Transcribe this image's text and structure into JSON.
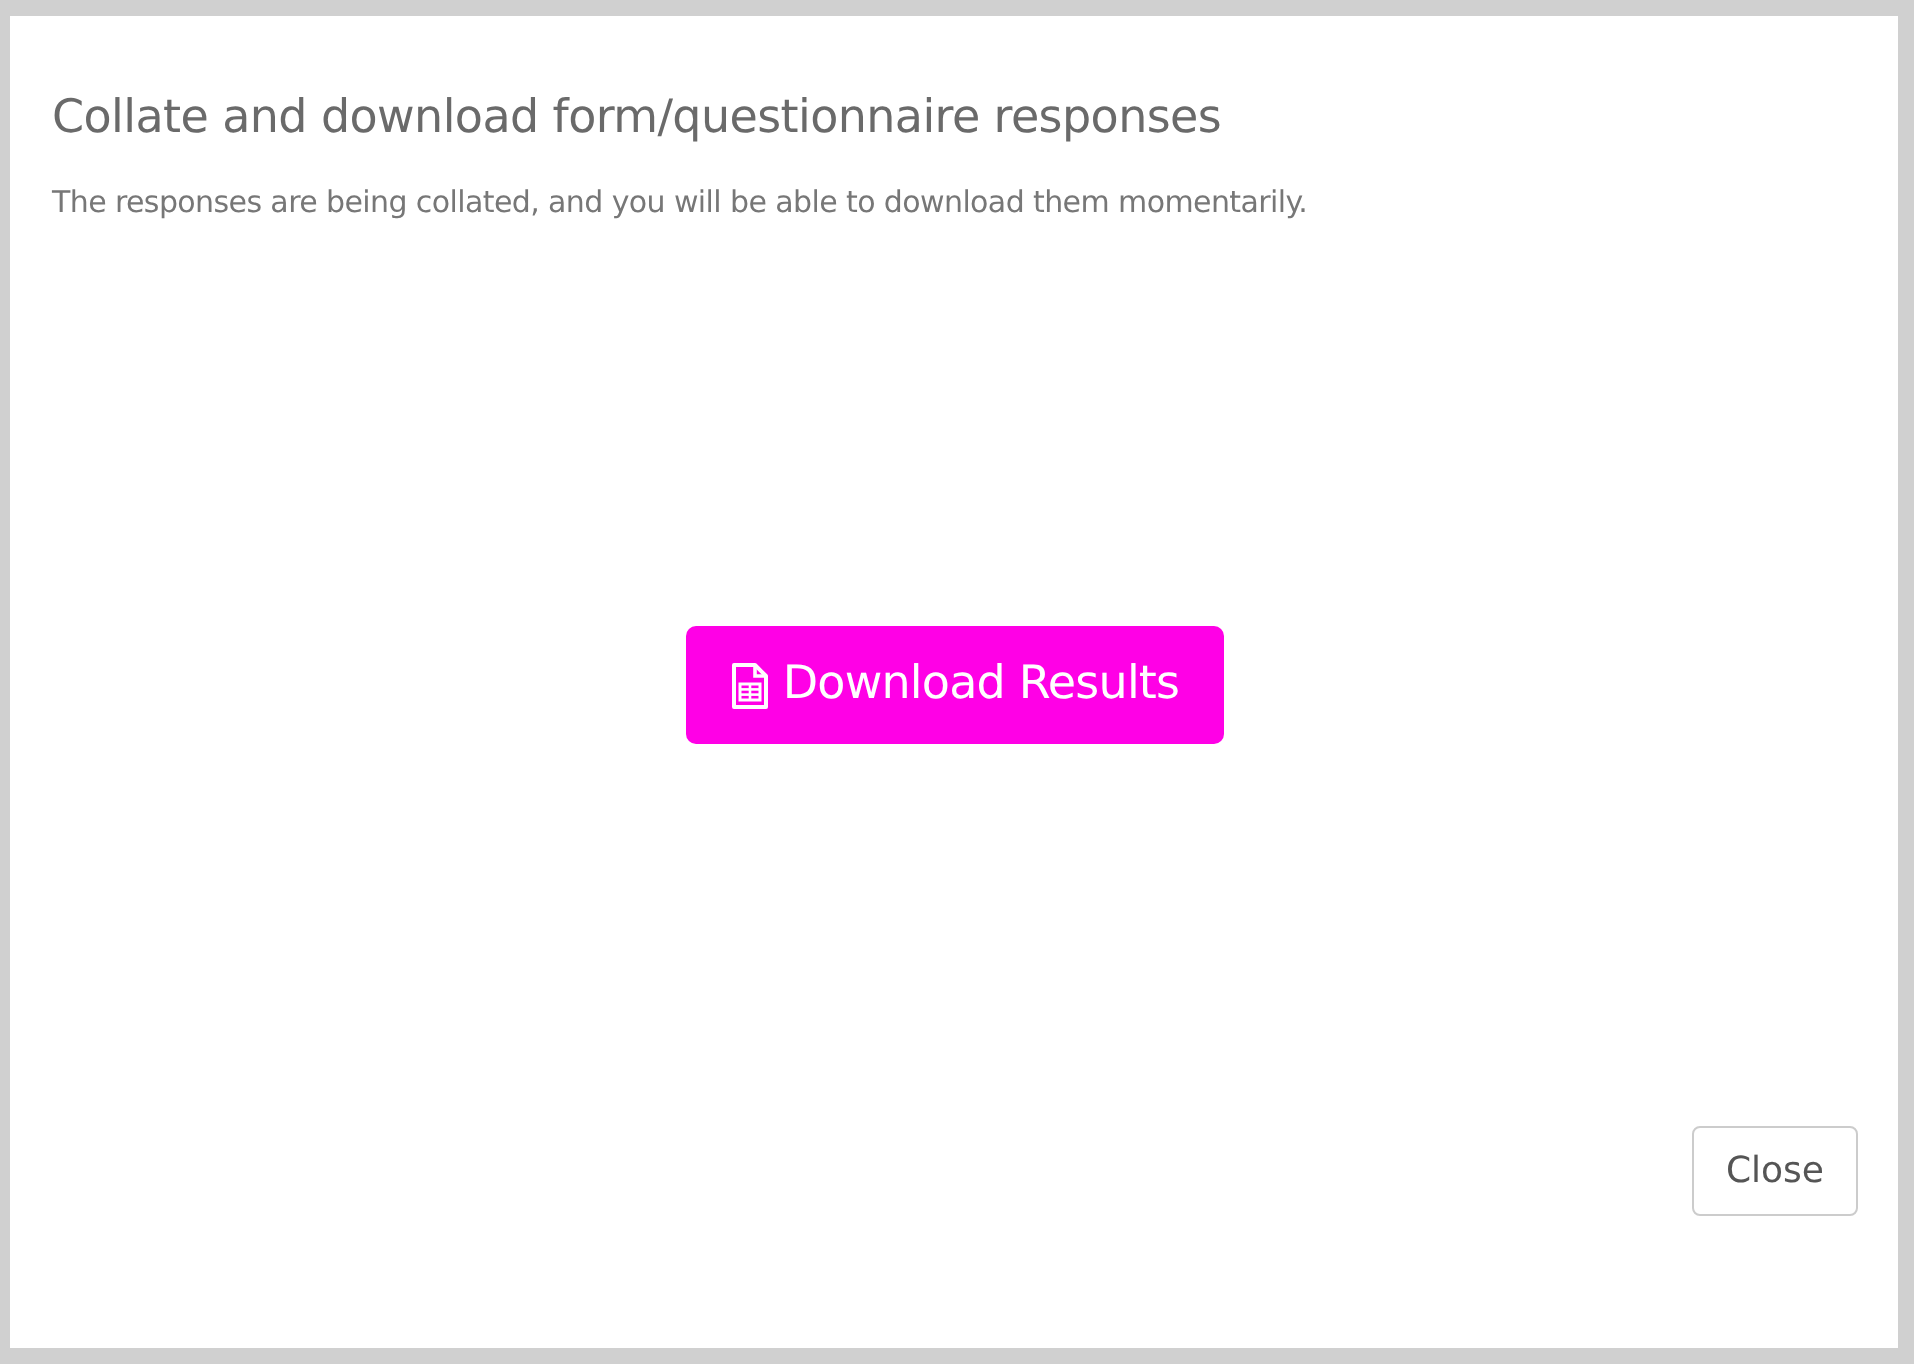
{
  "dialog": {
    "title": "Collate and download form/questionnaire responses",
    "message": "The responses are being collated, and you will be able to download them momentarily."
  },
  "download_button": {
    "label": "Download Results"
  },
  "footer_buttons": [
    {
      "label": "Close"
    }
  ]
}
